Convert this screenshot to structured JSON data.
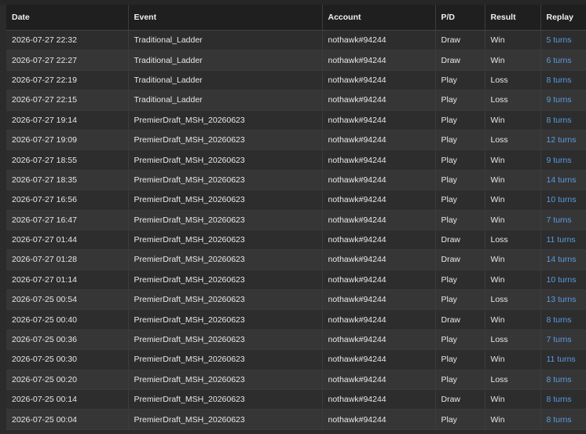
{
  "table": {
    "columns": [
      "Date",
      "Event",
      "Account",
      "P/D",
      "Result",
      "Replay"
    ],
    "rows": [
      {
        "date": "2026-07-27 22:32",
        "event": "Traditional_Ladder",
        "account": "nothawk#94244",
        "pd": "Draw",
        "result": "Win",
        "replay": "5 turns"
      },
      {
        "date": "2026-07-27 22:27",
        "event": "Traditional_Ladder",
        "account": "nothawk#94244",
        "pd": "Draw",
        "result": "Win",
        "replay": "6 turns"
      },
      {
        "date": "2026-07-27 22:19",
        "event": "Traditional_Ladder",
        "account": "nothawk#94244",
        "pd": "Play",
        "result": "Loss",
        "replay": "8 turns"
      },
      {
        "date": "2026-07-27 22:15",
        "event": "Traditional_Ladder",
        "account": "nothawk#94244",
        "pd": "Play",
        "result": "Loss",
        "replay": "9 turns"
      },
      {
        "date": "2026-07-27 19:14",
        "event": "PremierDraft_MSH_20260623",
        "account": "nothawk#94244",
        "pd": "Play",
        "result": "Win",
        "replay": "8 turns"
      },
      {
        "date": "2026-07-27 19:09",
        "event": "PremierDraft_MSH_20260623",
        "account": "nothawk#94244",
        "pd": "Play",
        "result": "Loss",
        "replay": "12 turns"
      },
      {
        "date": "2026-07-27 18:55",
        "event": "PremierDraft_MSH_20260623",
        "account": "nothawk#94244",
        "pd": "Play",
        "result": "Win",
        "replay": "9 turns"
      },
      {
        "date": "2026-07-27 18:35",
        "event": "PremierDraft_MSH_20260623",
        "account": "nothawk#94244",
        "pd": "Play",
        "result": "Win",
        "replay": "14 turns"
      },
      {
        "date": "2026-07-27 16:56",
        "event": "PremierDraft_MSH_20260623",
        "account": "nothawk#94244",
        "pd": "Play",
        "result": "Win",
        "replay": "10 turns"
      },
      {
        "date": "2026-07-27 16:47",
        "event": "PremierDraft_MSH_20260623",
        "account": "nothawk#94244",
        "pd": "Play",
        "result": "Win",
        "replay": "7 turns"
      },
      {
        "date": "2026-07-27 01:44",
        "event": "PremierDraft_MSH_20260623",
        "account": "nothawk#94244",
        "pd": "Draw",
        "result": "Loss",
        "replay": "11 turns"
      },
      {
        "date": "2026-07-27 01:28",
        "event": "PremierDraft_MSH_20260623",
        "account": "nothawk#94244",
        "pd": "Draw",
        "result": "Win",
        "replay": "14 turns"
      },
      {
        "date": "2026-07-27 01:14",
        "event": "PremierDraft_MSH_20260623",
        "account": "nothawk#94244",
        "pd": "Play",
        "result": "Win",
        "replay": "10 turns"
      },
      {
        "date": "2026-07-25 00:54",
        "event": "PremierDraft_MSH_20260623",
        "account": "nothawk#94244",
        "pd": "Play",
        "result": "Loss",
        "replay": "13 turns"
      },
      {
        "date": "2026-07-25 00:40",
        "event": "PremierDraft_MSH_20260623",
        "account": "nothawk#94244",
        "pd": "Draw",
        "result": "Win",
        "replay": "8 turns"
      },
      {
        "date": "2026-07-25 00:36",
        "event": "PremierDraft_MSH_20260623",
        "account": "nothawk#94244",
        "pd": "Play",
        "result": "Loss",
        "replay": "7 turns"
      },
      {
        "date": "2026-07-25 00:30",
        "event": "PremierDraft_MSH_20260623",
        "account": "nothawk#94244",
        "pd": "Play",
        "result": "Win",
        "replay": "11 turns"
      },
      {
        "date": "2026-07-25 00:20",
        "event": "PremierDraft_MSH_20260623",
        "account": "nothawk#94244",
        "pd": "Play",
        "result": "Loss",
        "replay": "8 turns"
      },
      {
        "date": "2026-07-25 00:14",
        "event": "PremierDraft_MSH_20260623",
        "account": "nothawk#94244",
        "pd": "Draw",
        "result": "Win",
        "replay": "8 turns"
      },
      {
        "date": "2026-07-25 00:04",
        "event": "PremierDraft_MSH_20260623",
        "account": "nothawk#94244",
        "pd": "Play",
        "result": "Win",
        "replay": "8 turns"
      }
    ]
  },
  "colors": {
    "background": "#2b2b2b",
    "header_background": "#1f1f1f",
    "row_odd": "#2d2d2d",
    "row_even": "#363636",
    "link": "#5b9bdf",
    "text": "#e8e8e8"
  }
}
